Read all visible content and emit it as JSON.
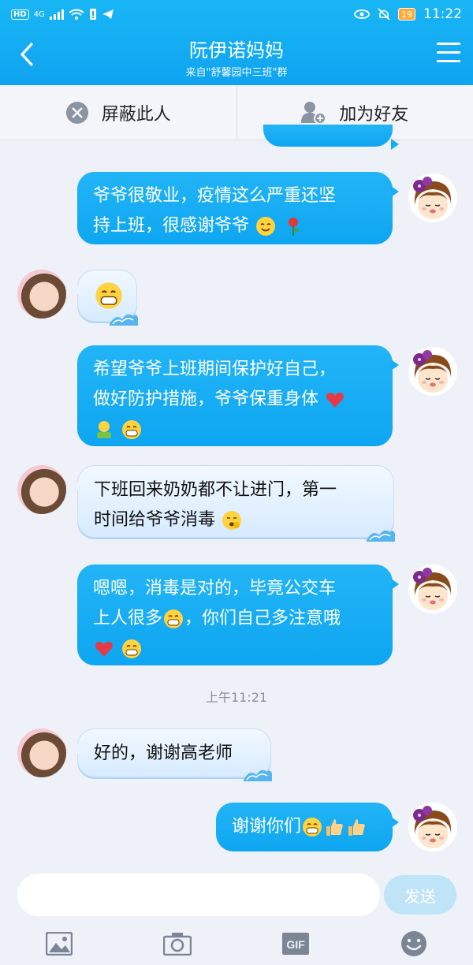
{
  "status": {
    "time": "11:22",
    "battery": "19",
    "hd": "HD",
    "net": "4G"
  },
  "header": {
    "title": "阮伊诺妈妈",
    "subtitle": "来自\"舒馨园中三班\"群"
  },
  "actions": {
    "block": "屏蔽此人",
    "add_friend": "加为好友"
  },
  "messages": [
    {
      "dir": "out",
      "line1": "爷爷很敬业，疫情这么严重还坚",
      "line2": "持上班，很感谢爷爷"
    },
    {
      "dir": "in"
    },
    {
      "dir": "out",
      "line1": "希望爷爷上班期间保护好自己，",
      "line2": "做好防护措施，爷爷保重身体"
    },
    {
      "dir": "in",
      "line1": "下班回来奶奶都不让进门，第一",
      "line2": "时间给爷爷消毒"
    },
    {
      "dir": "out",
      "line1": "嗯嗯，消毒是对的，毕竟公交车",
      "line2": "上人很多",
      "line2b": "，你们自己多注意哦"
    },
    {
      "dir": "in",
      "line1": "好的，谢谢高老师"
    },
    {
      "dir": "out",
      "line1": "谢谢你们"
    }
  ],
  "timestamp": "上午11:21",
  "input": {
    "placeholder": "",
    "send_label": "发送"
  },
  "toolbar": {
    "gif_label": "GIF"
  },
  "colors": {
    "header": "#12a9f3",
    "bubble_out": "#16abf4",
    "bubble_in": "#e4f1ff"
  }
}
